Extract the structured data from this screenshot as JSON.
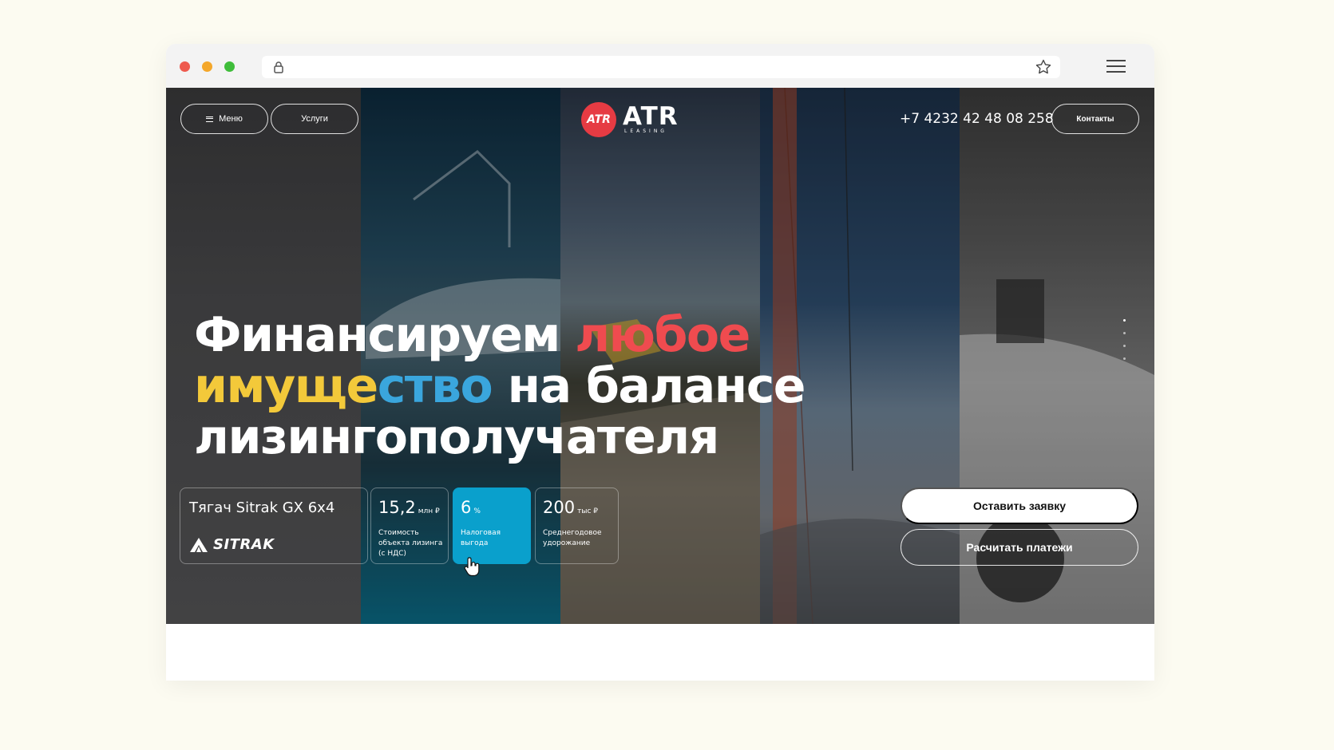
{
  "browser": {
    "icons": {
      "lock": "lock-icon",
      "bookmark": "star-icon",
      "menu": "hamburger-icon"
    }
  },
  "header": {
    "menu_label": "Меню",
    "services_label": "Услуги",
    "logo_badge": "ATR",
    "logo_word": "ATR",
    "logo_sub": "LEASING",
    "phone": "+7 4232 42 48 08 258",
    "contacts_label": "Контакты"
  },
  "hero": {
    "line1_white": "Финансируем ",
    "line1_red": "любое",
    "line2_yellow": "имуще",
    "line2_blue": "ство",
    "line2_white": " на балансе",
    "line3_white": "лизингополучателя",
    "colors": {
      "red": "#ef4b4f",
      "yellow": "#f3c93a",
      "blue": "#3aa6dd",
      "stat_active": "#0aa0cc"
    }
  },
  "product": {
    "title": "Тягач Sitrak GX 6x4",
    "brand": "SITRAK"
  },
  "stats": [
    {
      "value": "15,2",
      "unit": "млн ₽",
      "desc": "Стоимость объекта лизинга (с НДС)"
    },
    {
      "value": "6",
      "unit": "%",
      "desc": "Налоговая выгода"
    },
    {
      "value": "200",
      "unit": "тыс ₽",
      "desc": "Среднегодовое удорожание"
    }
  ],
  "cta": {
    "primary": "Оставить заявку",
    "secondary": "Расчитать платежи"
  }
}
